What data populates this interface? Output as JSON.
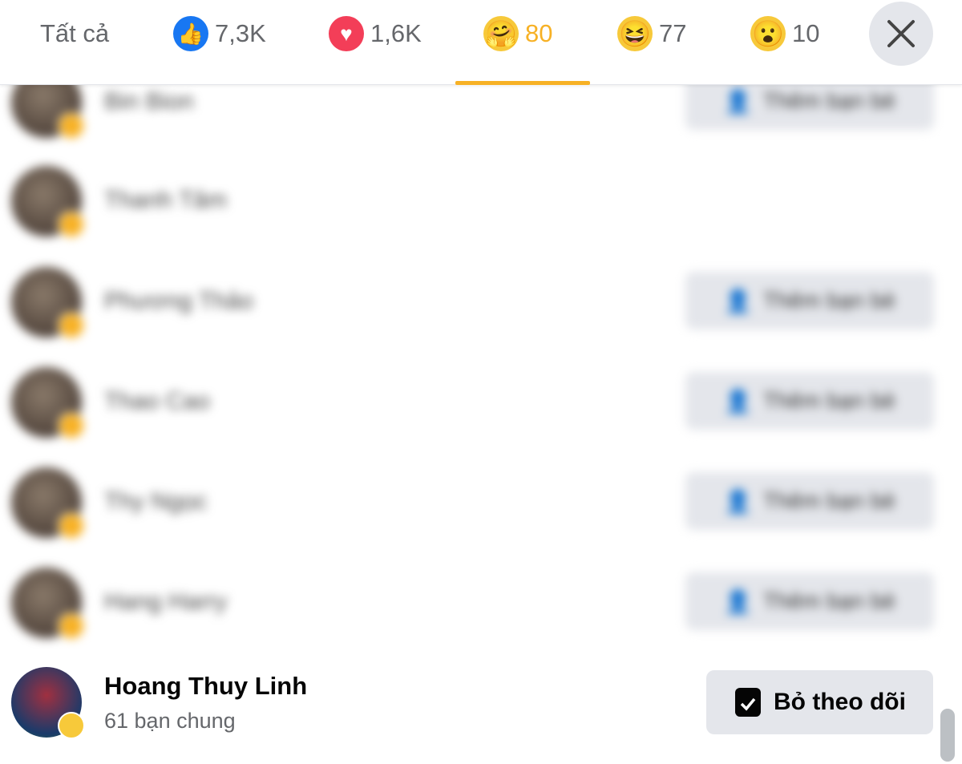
{
  "tabs": [
    {
      "label": "Tất cả",
      "icon": "none"
    },
    {
      "label": "7,3K",
      "icon": "like-icon",
      "color": "#1877f2"
    },
    {
      "label": "1,6K",
      "icon": "love-icon",
      "color": "#f33e58"
    },
    {
      "label": "80",
      "icon": "care-icon",
      "color": "#f7b125",
      "active": true
    },
    {
      "label": "77",
      "icon": "haha-icon",
      "color": "#f7b125"
    },
    {
      "label": "10",
      "icon": "wow-icon",
      "color": "#f7b125"
    }
  ],
  "accent": "#f7b125",
  "rows": [
    {
      "name": "Bin Bion",
      "button": "Thêm bạn bè"
    },
    {
      "name": "Thanh Tâm",
      "button": ""
    },
    {
      "name": "Phương Thảo",
      "button": "Thêm bạn bè"
    },
    {
      "name": "Thao Cao",
      "button": "Thêm bạn bè"
    },
    {
      "name": "Thy Ngọc",
      "button": "Thêm bạn bè"
    },
    {
      "name": "Hang Harry",
      "button": "Thêm bạn bè"
    }
  ],
  "featured": {
    "name": "Hoang Thuy Linh",
    "mutual": "61 bạn chung",
    "button": "Bỏ theo dõi"
  }
}
